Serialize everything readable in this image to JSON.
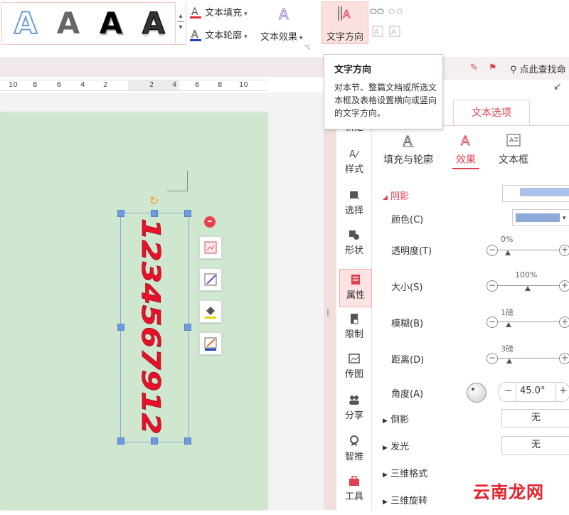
{
  "ribbon": {
    "wordart_letter": "A",
    "gallery_more": "▾",
    "text_fill": "文本填充",
    "text_outline": "文本轮廓",
    "text_effect": "文本效果",
    "text_direction": "文字方向"
  },
  "tooltip": {
    "title": "文字方向",
    "description": "对本节、整篇文档或所选文本框及表格设置横向或竖向的文字方向。"
  },
  "ruler": {
    "ticks": [
      "10",
      "8",
      "6",
      "4",
      "2",
      "2",
      "4",
      "6",
      "8",
      "10"
    ]
  },
  "textbox": {
    "content": "1234567912",
    "color": "#e8102a"
  },
  "pane": {
    "search": "点此查找命",
    "tab_partial": "新建",
    "vertical_tabs": [
      "样式",
      "选择",
      "形状",
      "属性",
      "限制",
      "传图",
      "分享",
      "智推",
      "工具"
    ],
    "panel_tab": "文本选项",
    "subtabs": [
      "填充与轮廓",
      "效果",
      "文本框"
    ],
    "shadow_section": "阴影",
    "color_label": "颜色(C)",
    "shadow_color": "#8fa9d8",
    "rows": [
      {
        "label": "透明度(T)",
        "value": "0%"
      },
      {
        "label": "大小(S)",
        "value": "100%"
      },
      {
        "label": "模糊(B)",
        "value": "1磅"
      },
      {
        "label": "距离(D)",
        "value": "3磅"
      }
    ],
    "angle_label": "角度(A)",
    "angle_value": "45.0°",
    "reflection_label": "倒影",
    "reflection_value": "无",
    "glow_label": "发光",
    "glow_value": "无",
    "format3d_label": "三维格式",
    "rotate3d_label": "三维旋转"
  },
  "watermark": "云南龙网",
  "colors": {
    "accent": "#e04050",
    "page": "#cfe6cf"
  }
}
